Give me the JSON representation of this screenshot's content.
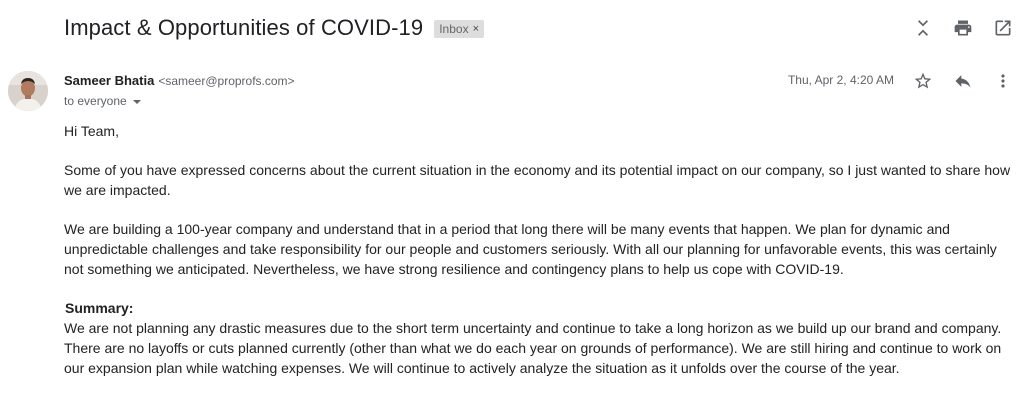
{
  "email": {
    "subject": "Impact & Opportunities of COVID-19",
    "label_chip": "Inbox",
    "sender_name": "Sameer Bhatia",
    "sender_email": "<sameer@proprofs.com>",
    "recipients": "to everyone",
    "date": "Thu, Apr 2, 4:20 AM",
    "greeting": "Hi Team,",
    "paragraph1": "Some of you have expressed concerns about the current situation in the economy and its potential impact on our company, so I just wanted to share how we are impacted.",
    "paragraph2": "We are building a 100-year company and understand that in a period that long there will be many events that happen. We plan for dynamic and unpredictable challenges and take responsibility for our people and customers seriously. With all our planning for unfavorable events, this was certainly not something we anticipated. Nevertheless, we have strong resilience and contingency plans to help us cope with COVID-19.",
    "summary_heading": "Summary:",
    "summary_text": "We are not planning any drastic measures due to the short term uncertainty and continue to take a long horizon as we build up our brand and company. There are no layoffs or cuts planned currently (other than what we do each year on grounds of performance). We are still hiring and continue to work on our expansion plan while watching expenses. We will continue to actively analyze the situation as it unfolds over the course of the year."
  },
  "icons": {
    "collapse": "collapse-all-icon",
    "print": "print-icon",
    "new_window": "open-in-new-window-icon",
    "star": "star-icon",
    "reply": "reply-icon",
    "more": "more-vertical-icon"
  },
  "colors": {
    "text": "#222222",
    "secondary": "#5f6368",
    "chip_bg": "#dddddd"
  }
}
